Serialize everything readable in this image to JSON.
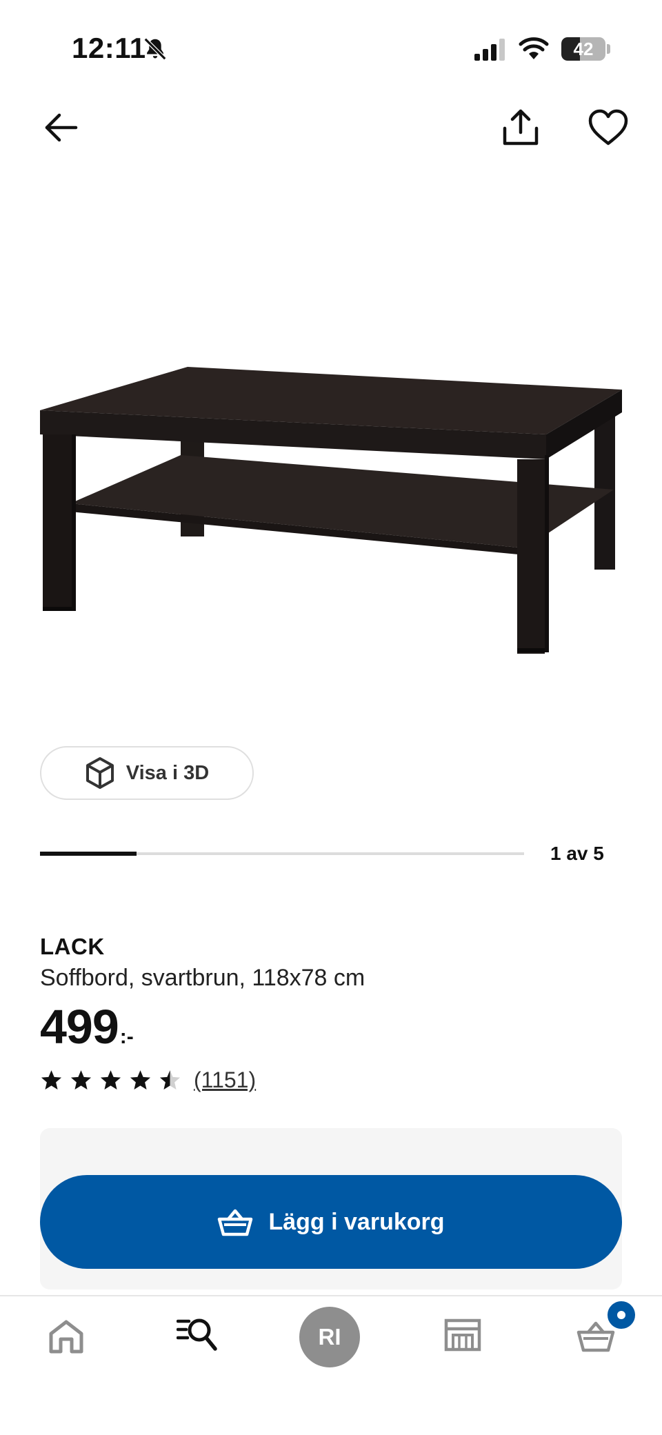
{
  "status_bar": {
    "time": "12:11",
    "battery_level": "42",
    "icons": [
      "bell-slash-icon",
      "cellular-signal-icon",
      "wifi-icon",
      "battery-icon"
    ]
  },
  "top_nav": {
    "icons": [
      "arrow-left-icon",
      "share-icon",
      "heart-icon"
    ]
  },
  "gallery": {
    "view_3d_label": "Visa i 3D",
    "position_label": "1 av 5",
    "progress_fraction": 0.2
  },
  "product": {
    "name": "LACK",
    "description": "Soffbord, svartbrun, 118x78 cm",
    "price": "499",
    "price_suffix": ":-",
    "rating": 4.5,
    "review_count": "(1151)"
  },
  "cart": {
    "add_label": "Lägg i varukorg",
    "accent_color": "#0058a3"
  },
  "tab_bar": {
    "profile_initials": "RI",
    "icons": [
      "home-icon",
      "search-icon",
      "profile-avatar",
      "store-icon",
      "basket-icon"
    ]
  }
}
